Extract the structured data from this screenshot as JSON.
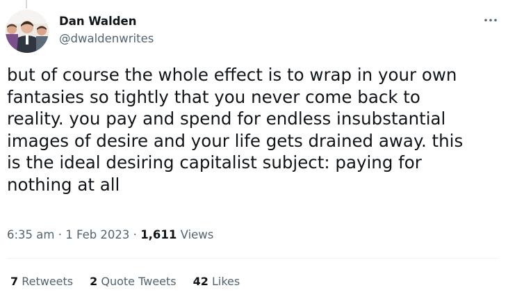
{
  "author": {
    "name": "Dan Walden",
    "handle": "@dwaldenwrites"
  },
  "tweet": {
    "text": "but of course the whole effect is to wrap in your own\nfantasies so tightly that you never come back to\nreality. you pay and spend for endless insubstantial\nimages of desire and your life gets drained away. this\nis the ideal desiring capitalist subject: paying for\nnothing at all",
    "time": "6:35 am",
    "date": "1 Feb 2023",
    "separator": " · ",
    "views_count": "1,611",
    "views_label": "Views"
  },
  "stats": {
    "retweets": {
      "count": "7",
      "label": "Retweets"
    },
    "quote_tweets": {
      "count": "2",
      "label": "Quote Tweets"
    },
    "likes": {
      "count": "42",
      "label": "Likes"
    }
  },
  "icons": {
    "more": "more-horizontal-icon"
  },
  "colors": {
    "text_primary": "#0f1419",
    "text_secondary": "#536471",
    "divider": "#eff3f4"
  }
}
